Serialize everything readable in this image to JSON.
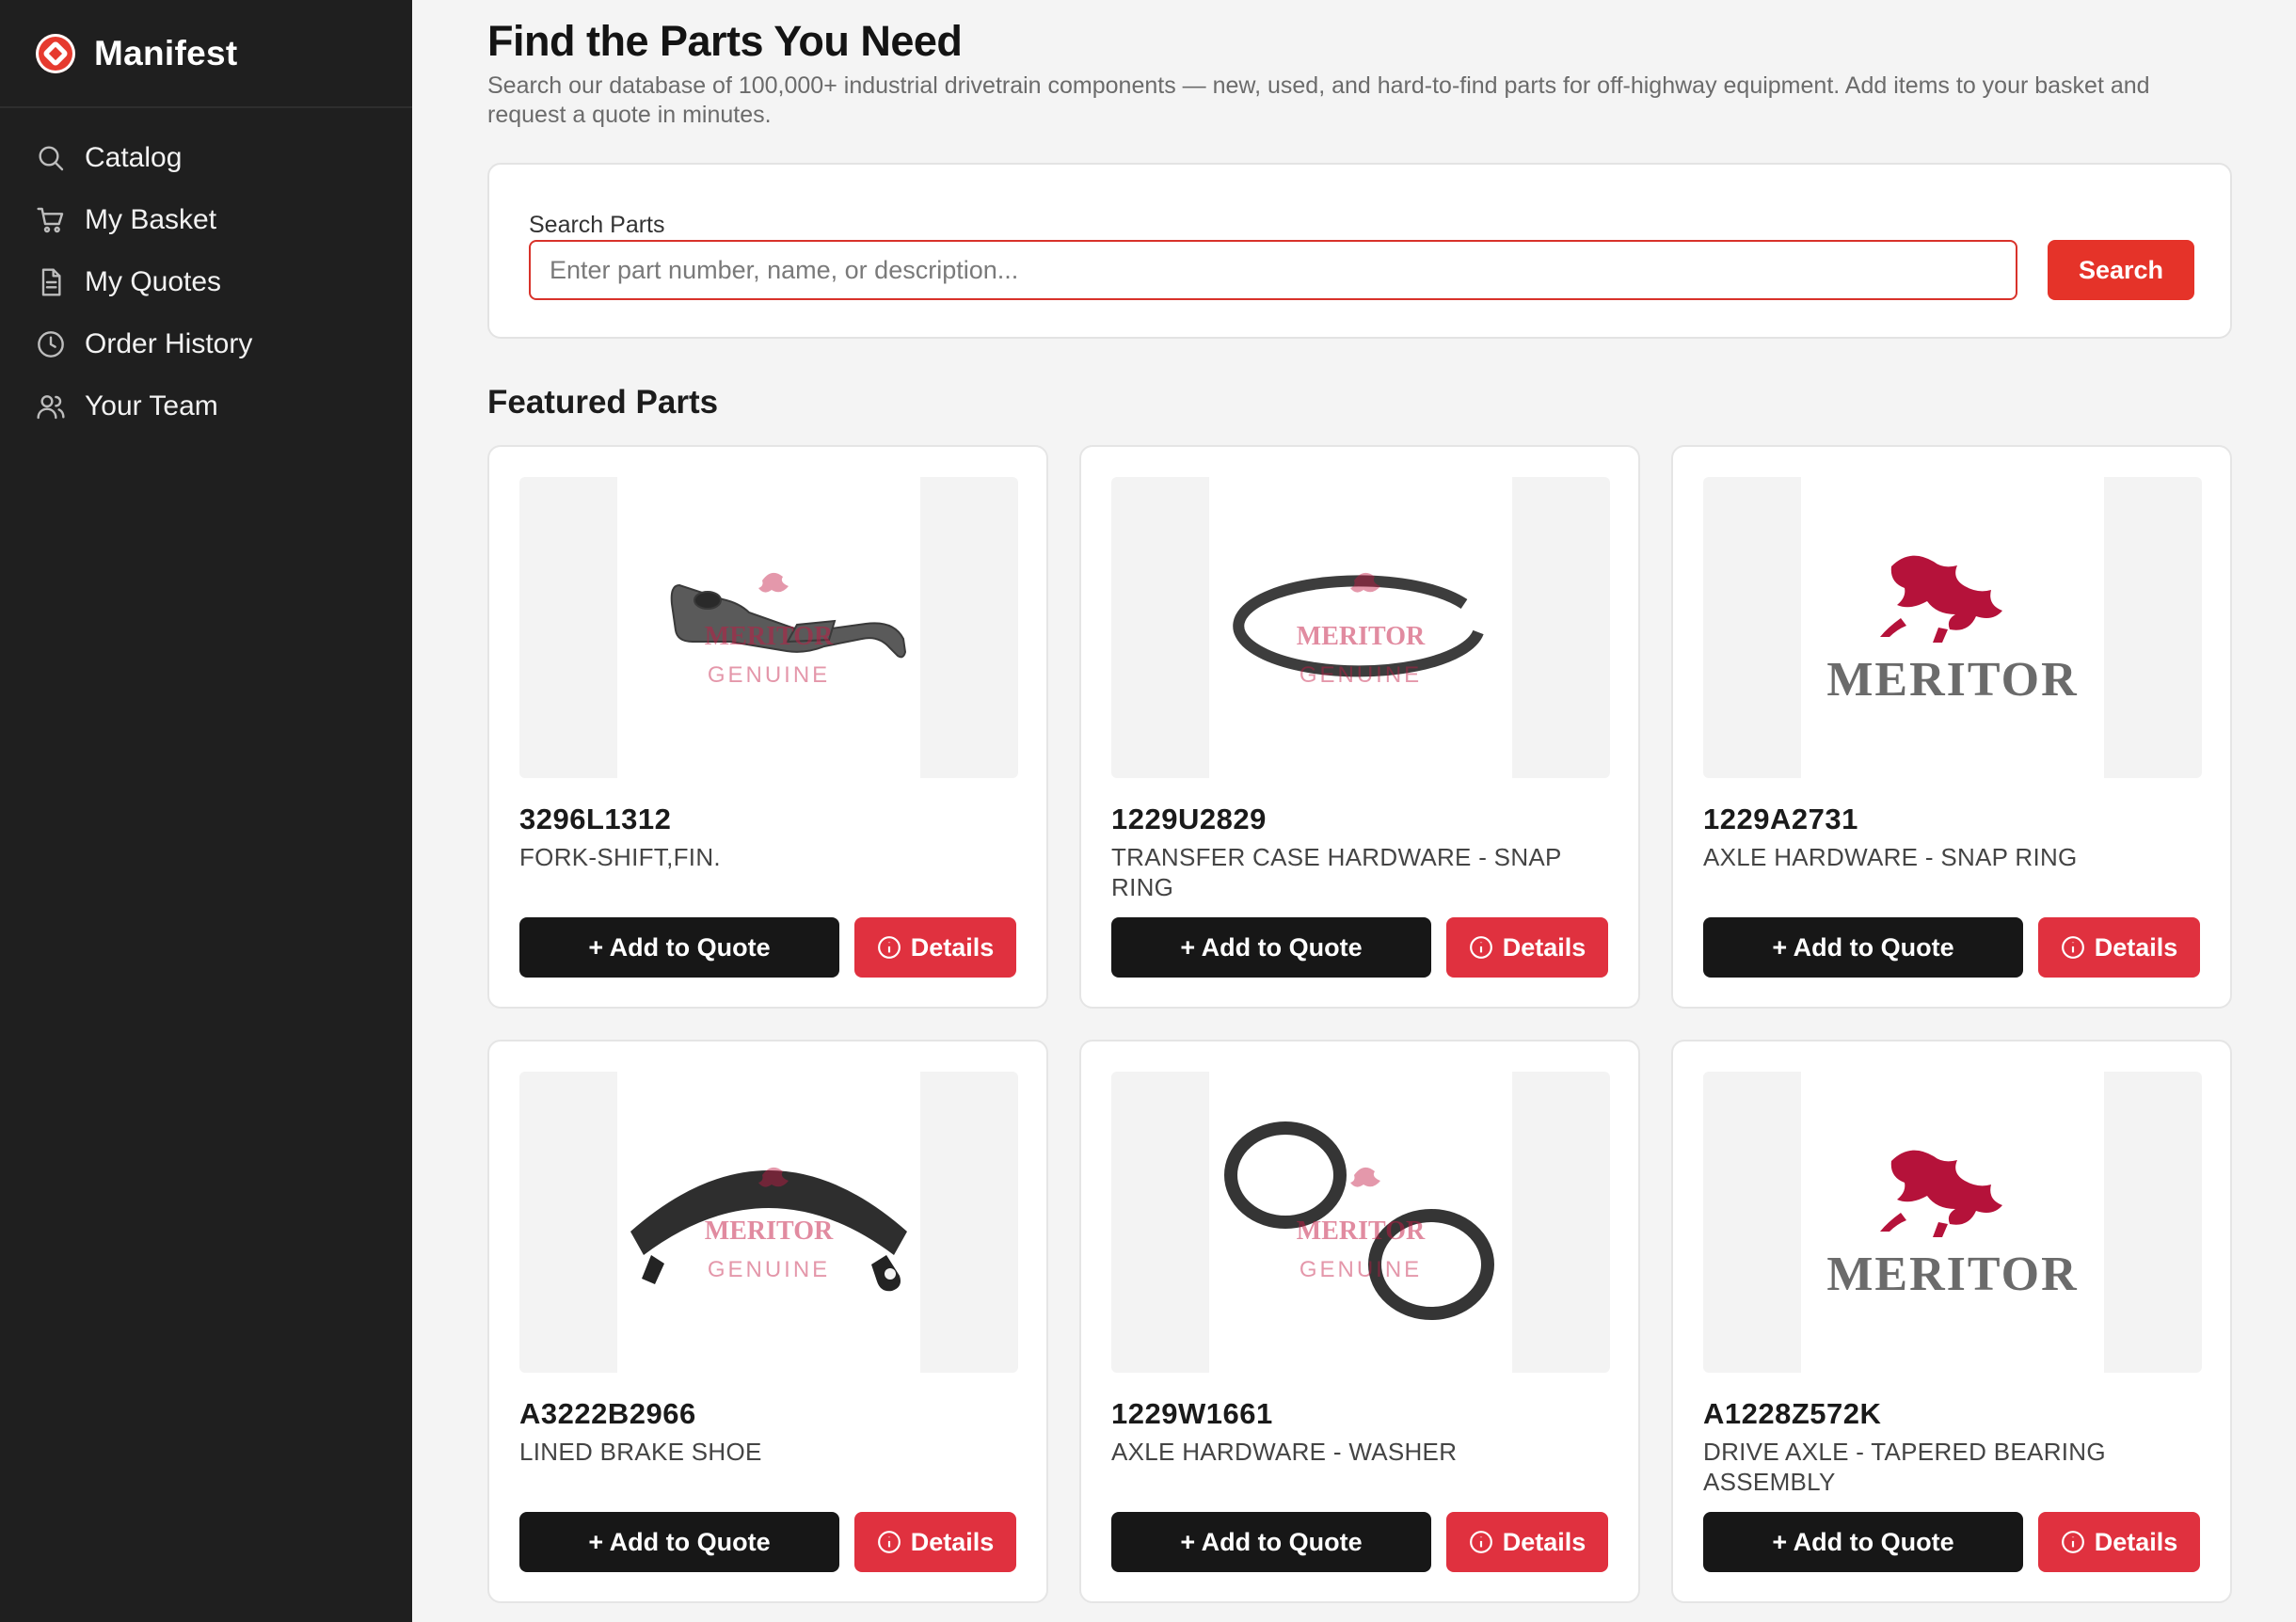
{
  "app": {
    "name": "Manifest"
  },
  "sidebar": {
    "items": [
      {
        "label": "Catalog",
        "icon": "search-icon"
      },
      {
        "label": "My Basket",
        "icon": "cart-icon"
      },
      {
        "label": "My Quotes",
        "icon": "document-icon"
      },
      {
        "label": "Order History",
        "icon": "clock-icon"
      },
      {
        "label": "Your Team",
        "icon": "users-icon"
      }
    ]
  },
  "header": {
    "title": "Find the Parts You Need",
    "subtitle": "Search our database of 100,000+ industrial drivetrain components — new, used, and hard-to-find parts for off-highway equipment. Add items to your basket and request a quote in minutes."
  },
  "search": {
    "label": "Search Parts",
    "placeholder": "Enter part number, name, or description...",
    "value": "",
    "button_label": "Search"
  },
  "featured": {
    "title": "Featured Parts",
    "add_label": "+ Add to Quote",
    "details_label": "Details",
    "watermark_brand": "MERITOR",
    "watermark_sub": "GENUINE",
    "parts": [
      {
        "number": "3296L1312",
        "name": "FORK-SHIFT,FIN.",
        "image": "shift-fork"
      },
      {
        "number": "1229U2829",
        "name": "TRANSFER CASE HARDWARE - SNAP RING",
        "image": "snap-ring"
      },
      {
        "number": "1229A2731",
        "name": "AXLE HARDWARE - SNAP RING",
        "image": "meritor-logo"
      },
      {
        "number": "A3222B2966",
        "name": "LINED BRAKE SHOE",
        "image": "brake-shoe"
      },
      {
        "number": "1229W1661",
        "name": "AXLE HARDWARE - WASHER",
        "image": "washers"
      },
      {
        "number": "A1228Z572K",
        "name": "DRIVE AXLE - TAPERED BEARING ASSEMBLY",
        "image": "meritor-logo"
      }
    ]
  },
  "colors": {
    "accent": "#e53329",
    "details": "#e0313f",
    "sidebar": "#1f1f1f",
    "brand_red": "#b5123a"
  }
}
